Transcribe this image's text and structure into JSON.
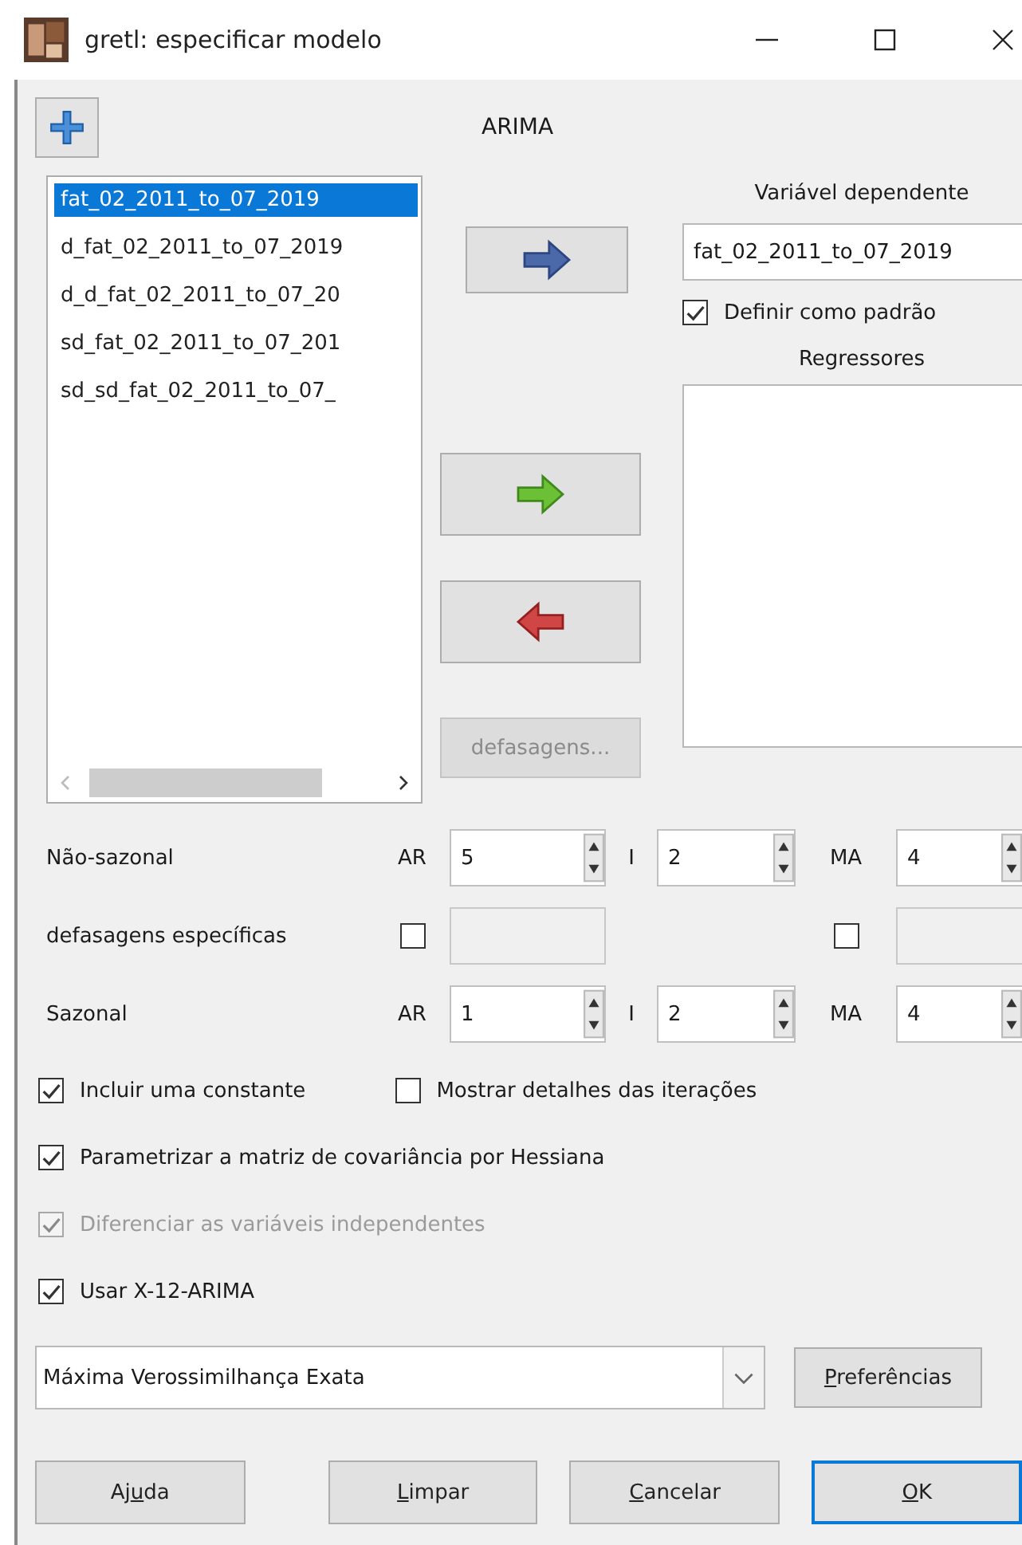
{
  "window": {
    "title": "gretl: especificar modelo"
  },
  "heading": "ARIMA",
  "variables": [
    {
      "label": "fat_02_2011_to_07_2019",
      "selected": true
    },
    {
      "label": "d_fat_02_2011_to_07_2019",
      "selected": false
    },
    {
      "label": "d_d_fat_02_2011_to_07_20",
      "selected": false
    },
    {
      "label": "sd_fat_02_2011_to_07_201",
      "selected": false
    },
    {
      "label": "sd_sd_fat_02_2011_to_07_",
      "selected": false
    }
  ],
  "dependent": {
    "label": "Variável dependente",
    "value": "fat_02_2011_to_07_2019"
  },
  "set_default": {
    "label": "Definir como padrão",
    "checked": true
  },
  "regressors": {
    "label": "Regressores"
  },
  "lags_button": {
    "label": "defasagens...",
    "disabled": true
  },
  "orders": [
    {
      "kind": "spin",
      "label": "Não-sazonal",
      "fields": [
        {
          "label": "AR",
          "value": "5"
        },
        {
          "label": "I",
          "value": "2"
        },
        {
          "label": "MA",
          "value": "4"
        }
      ]
    },
    {
      "kind": "lags",
      "label": "defasagens específicas",
      "checks": [
        {
          "checked": false
        },
        {
          "checked": false
        }
      ]
    },
    {
      "kind": "spin",
      "label": "Sazonal",
      "fields": [
        {
          "label": "AR",
          "value": "1"
        },
        {
          "label": "I",
          "value": "2"
        },
        {
          "label": "MA",
          "value": "4"
        }
      ]
    }
  ],
  "options": [
    [
      {
        "label": "Incluir uma constante",
        "checked": true,
        "disabled": false
      },
      {
        "label": "Mostrar detalhes das iterações",
        "checked": false,
        "disabled": false
      }
    ],
    [
      {
        "label": "Parametrizar a matriz de covariância por Hessiana",
        "checked": true,
        "disabled": false
      }
    ],
    [
      {
        "label": "Diferenciar as variáveis independentes",
        "checked": true,
        "disabled": true
      }
    ],
    [
      {
        "label": "Usar X-12-ARIMA",
        "checked": true,
        "disabled": false
      }
    ]
  ],
  "estimator": {
    "value": "Máxima Verossimilhança Exata"
  },
  "preferences_button": {
    "key": "P",
    "post": "referências"
  },
  "buttons": [
    {
      "pre": "Aj",
      "key": "u",
      "post": "da",
      "focused": false
    },
    {
      "key": "L",
      "post": "impar",
      "focused": false
    },
    {
      "key": "C",
      "post": "ancelar",
      "focused": false
    },
    {
      "key": "O",
      "post": "K",
      "focused": true
    }
  ]
}
